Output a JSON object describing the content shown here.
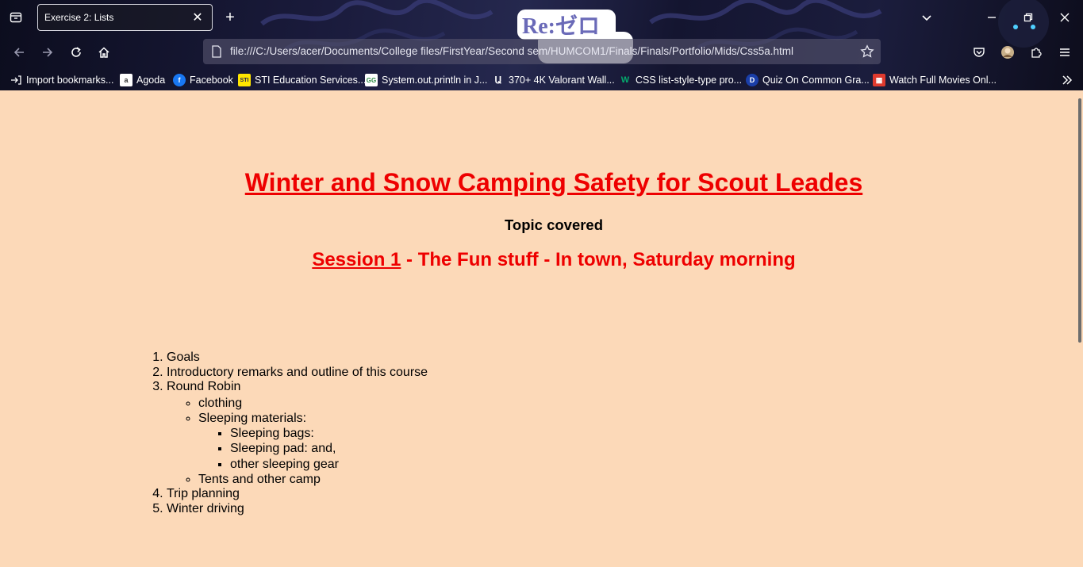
{
  "browser": {
    "tab_title": "Exercise 2: Lists",
    "tab_close_glyph": "✕",
    "newtab_glyph": "+",
    "logo_text": "Re:ゼロ",
    "url": "file:///C:/Users/acer/Documents/College files/FirstYear/Second sem/HUMCOM1/Finals/Finals/Portfolio/Mids/Css5a.html",
    "bookmarks": [
      {
        "label": "Import bookmarks...",
        "icon": "import-icon"
      },
      {
        "label": "Agoda",
        "icon": "agoda-icon"
      },
      {
        "label": "Facebook",
        "icon": "facebook-icon"
      },
      {
        "label": "STI Education Services...",
        "icon": "sti-icon"
      },
      {
        "label": "System.out.println in J...",
        "icon": "geeksforgeeks-icon"
      },
      {
        "label": "370+ 4K Valorant Wall...",
        "icon": "valorant-icon"
      },
      {
        "label": "CSS list-style-type pro...",
        "icon": "w3schools-icon"
      },
      {
        "label": "Quiz On Common Gra...",
        "icon": "quiz-icon"
      },
      {
        "label": "Watch Full Movies Onl...",
        "icon": "movies-icon"
      }
    ]
  },
  "page": {
    "title": "Winter and Snow Camping Safety for Scout Leades",
    "subtitle": "Topic covered",
    "session_link": "Session 1",
    "session_rest": " - The Fun stuff - In town, Saturday morning",
    "list": {
      "item1": "Goals",
      "item2": "Introductory remarks and outline of this course",
      "item3": "Round Robin",
      "item3_sub1": "clothing",
      "item3_sub2": "Sleeping materials:",
      "item3_sub2_sub1": "Sleeping bags:",
      "item3_sub2_sub2": "Sleeping pad: and,",
      "item3_sub2_sub3": "other sleeping gear",
      "item3_sub3": "Tents and other camp",
      "item4": "Trip planning",
      "item5": "Winter driving"
    }
  },
  "colors": {
    "page_background": "#fcd9b8",
    "heading_red": "#ee0000"
  }
}
